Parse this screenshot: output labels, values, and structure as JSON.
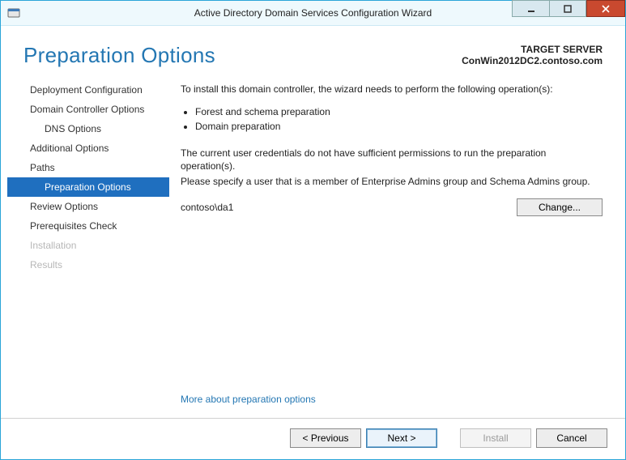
{
  "window": {
    "title": "Active Directory Domain Services Configuration Wizard"
  },
  "header": {
    "page_title": "Preparation Options",
    "target_label": "TARGET SERVER",
    "target_server": "ConWin2012DC2.contoso.com"
  },
  "sidebar": {
    "items": [
      {
        "label": "Deployment Configuration",
        "selected": false,
        "disabled": false,
        "sub": false
      },
      {
        "label": "Domain Controller Options",
        "selected": false,
        "disabled": false,
        "sub": false
      },
      {
        "label": "DNS Options",
        "selected": false,
        "disabled": false,
        "sub": true
      },
      {
        "label": "Additional Options",
        "selected": false,
        "disabled": false,
        "sub": false
      },
      {
        "label": "Paths",
        "selected": false,
        "disabled": false,
        "sub": false
      },
      {
        "label": "Preparation Options",
        "selected": true,
        "disabled": false,
        "sub": true
      },
      {
        "label": "Review Options",
        "selected": false,
        "disabled": false,
        "sub": false
      },
      {
        "label": "Prerequisites Check",
        "selected": false,
        "disabled": false,
        "sub": false
      },
      {
        "label": "Installation",
        "selected": false,
        "disabled": true,
        "sub": false
      },
      {
        "label": "Results",
        "selected": false,
        "disabled": true,
        "sub": false
      }
    ]
  },
  "main": {
    "intro": "To install this domain controller, the wizard needs to perform the following operation(s):",
    "bullets": [
      "Forest and schema preparation",
      "Domain preparation"
    ],
    "warning_line1": "The current user credentials do not have sufficient permissions to run the preparation operation(s).",
    "warning_line2": "Please specify a user that is a member of Enterprise Admins group and Schema Admins group.",
    "credential_value": "contoso\\da1",
    "change_label": "Change...",
    "more_link": "More about preparation options"
  },
  "footer": {
    "previous": "< Previous",
    "next": "Next >",
    "install": "Install",
    "cancel": "Cancel"
  }
}
